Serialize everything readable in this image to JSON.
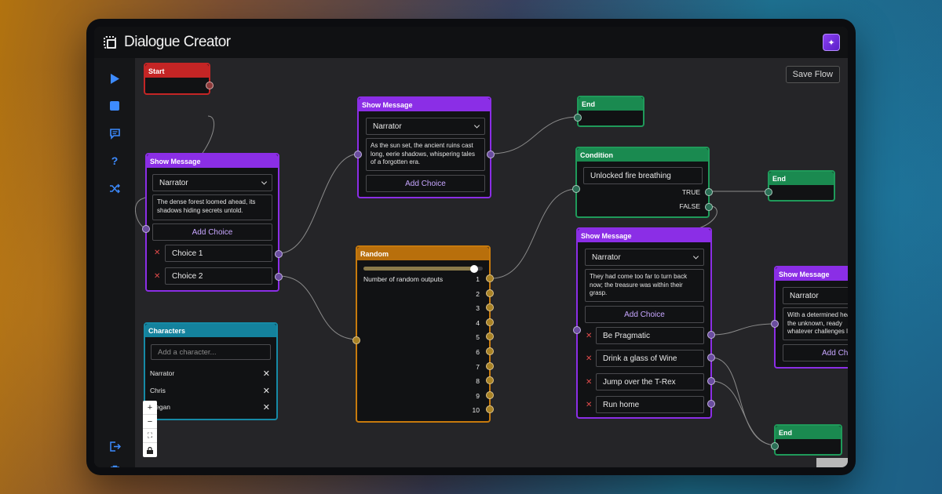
{
  "app": {
    "title": "Dialogue Creator",
    "avatar_icon": "bot-avatar-icon"
  },
  "sidebar": {
    "items": [
      {
        "name": "play-icon"
      },
      {
        "name": "stop-icon"
      },
      {
        "name": "chat-icon"
      },
      {
        "name": "help-icon"
      },
      {
        "name": "shuffle-icon"
      },
      {
        "name": "export-icon"
      },
      {
        "name": "trash-icon"
      }
    ]
  },
  "toolbar": {
    "save_label": "Save Flow"
  },
  "zoom": {
    "plus": "+",
    "minus": "−",
    "fit": "⛶",
    "lock": "🔒"
  },
  "nodes": {
    "start": {
      "title": "Start"
    },
    "msg1": {
      "title": "Show Message",
      "character": "Narrator",
      "text": "The dense forest loomed ahead, its shadows hiding secrets untold.",
      "add_choice": "Add Choice",
      "choices": [
        "Choice 1",
        "Choice 2"
      ]
    },
    "msg2": {
      "title": "Show Message",
      "character": "Narrator",
      "text": "As the sun set, the ancient ruins cast long, eerie shadows, whispering tales of a forgotten era.",
      "add_choice": "Add Choice"
    },
    "end1": {
      "title": "End"
    },
    "condition": {
      "title": "Condition",
      "value": "Unlocked fire breathing",
      "true_label": "TRUE",
      "false_label": "FALSE"
    },
    "end2": {
      "title": "End"
    },
    "random": {
      "title": "Random",
      "label": "Number of random outputs",
      "slider_fraction": 0.93,
      "outputs": [
        "1",
        "2",
        "3",
        "4",
        "5",
        "6",
        "7",
        "8",
        "9",
        "10"
      ]
    },
    "characters": {
      "title": "Characters",
      "placeholder": "Add a character...",
      "list": [
        "Narrator",
        "Chris",
        "Megan"
      ]
    },
    "msg3": {
      "title": "Show Message",
      "character": "Narrator",
      "text": "They had come too far to turn back now; the treasure was within their grasp.",
      "add_choice": "Add Choice",
      "choices": [
        "Be Pragmatic",
        "Drink a glass of Wine",
        "Jump over the T-Rex",
        "Run home"
      ]
    },
    "msg4": {
      "title": "Show Message",
      "character": "Narrator",
      "text": "With a determined heart, into the unknown, ready whatever challenges lay",
      "add_choice": "Add Choic"
    },
    "end3": {
      "title": "End"
    }
  },
  "colors": {
    "accent_blue": "#3d8bff",
    "purple": "#8b2ee6",
    "red": "#c42525",
    "green": "#1a8a50",
    "orange": "#b86f0c",
    "teal": "#14829d"
  }
}
